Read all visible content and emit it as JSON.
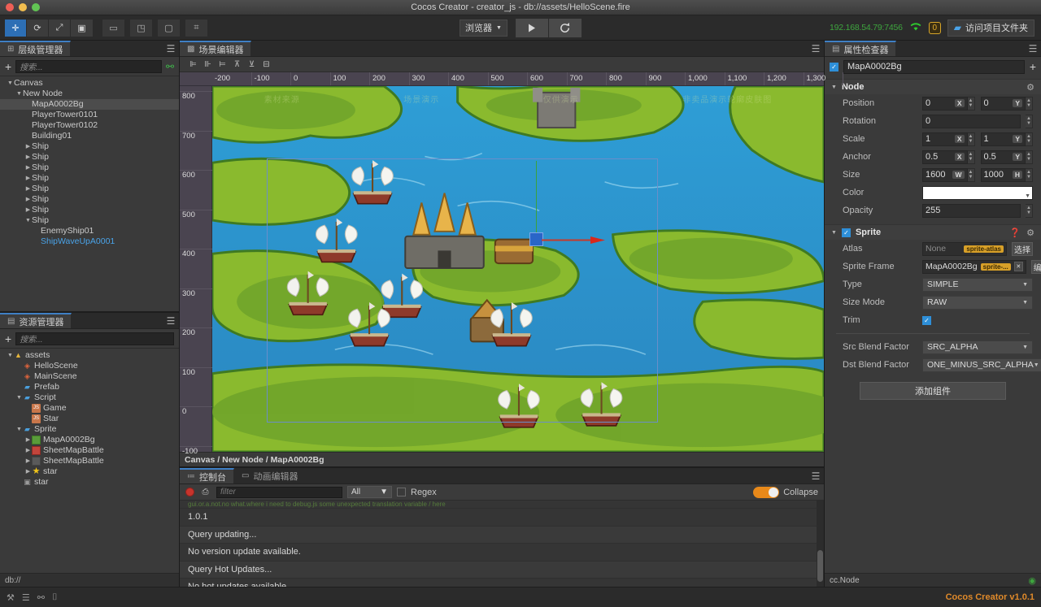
{
  "window": {
    "title": "Cocos Creator - creator_js - db://assets/HelloScene.fire"
  },
  "toolbar": {
    "left_tools": [
      {
        "name": "move-tool",
        "glyph": "✛",
        "active": true
      },
      {
        "name": "rotate-tool",
        "glyph": "⟳",
        "active": false
      },
      {
        "name": "scale-tool",
        "glyph": "⤢",
        "active": false
      },
      {
        "name": "rect-tool",
        "glyph": "▣",
        "active": false
      }
    ],
    "transform_tools": [
      {
        "name": "pivot-toggle",
        "glyph": "▬",
        "active": false
      },
      {
        "name": "coordinate-toggle",
        "glyph": "◰",
        "active": false
      }
    ],
    "display_tools": [
      {
        "name": "gizmo-toggle",
        "glyph": "▢",
        "active": false
      },
      {
        "name": "snap-toggle",
        "glyph": "⌗",
        "active": false
      }
    ],
    "preview_target": "浏览器",
    "play_label": "▶",
    "refresh_label": "⟳",
    "ip_address": "192.168.54.79:7456",
    "wifi_icon": "wifi-icon",
    "notification_count": "0",
    "open_folder_label": "访问项目文件夹"
  },
  "hierarchy": {
    "tab_label": "层级管理器",
    "search_placeholder": "搜索...",
    "add_label": "+",
    "link_label": "⚯",
    "nodes": [
      {
        "label": "Canvas",
        "depth": 0,
        "arrow": "down",
        "selected": false,
        "blue": false
      },
      {
        "label": "New Node",
        "depth": 1,
        "arrow": "down",
        "selected": false,
        "blue": false
      },
      {
        "label": "MapA0002Bg",
        "depth": 2,
        "arrow": "none",
        "selected": true,
        "blue": false
      },
      {
        "label": "PlayerTower0101",
        "depth": 2,
        "arrow": "none",
        "selected": false,
        "blue": false
      },
      {
        "label": "PlayerTower0102",
        "depth": 2,
        "arrow": "none",
        "selected": false,
        "blue": false
      },
      {
        "label": "Building01",
        "depth": 2,
        "arrow": "none",
        "selected": false,
        "blue": false
      },
      {
        "label": "Ship",
        "depth": 2,
        "arrow": "right",
        "selected": false,
        "blue": false
      },
      {
        "label": "Ship",
        "depth": 2,
        "arrow": "right",
        "selected": false,
        "blue": false
      },
      {
        "label": "Ship",
        "depth": 2,
        "arrow": "right",
        "selected": false,
        "blue": false
      },
      {
        "label": "Ship",
        "depth": 2,
        "arrow": "right",
        "selected": false,
        "blue": false
      },
      {
        "label": "Ship",
        "depth": 2,
        "arrow": "right",
        "selected": false,
        "blue": false
      },
      {
        "label": "Ship",
        "depth": 2,
        "arrow": "right",
        "selected": false,
        "blue": false
      },
      {
        "label": "Ship",
        "depth": 2,
        "arrow": "right",
        "selected": false,
        "blue": false
      },
      {
        "label": "Ship",
        "depth": 2,
        "arrow": "down",
        "selected": false,
        "blue": false
      },
      {
        "label": "EnemyShip01",
        "depth": 3,
        "arrow": "none",
        "selected": false,
        "blue": false
      },
      {
        "label": "ShipWaveUpA0001",
        "depth": 3,
        "arrow": "none",
        "selected": false,
        "blue": true
      }
    ]
  },
  "assets": {
    "tab_label": "资源管理器",
    "search_placeholder": "搜索...",
    "add_label": "+",
    "db_path": "db://",
    "nodes": [
      {
        "label": "assets",
        "depth": 0,
        "arrow": "down",
        "icon": "assets-root"
      },
      {
        "label": "HelloScene",
        "depth": 1,
        "arrow": "none",
        "icon": "fire"
      },
      {
        "label": "MainScene",
        "depth": 1,
        "arrow": "none",
        "icon": "fire"
      },
      {
        "label": "Prefab",
        "depth": 1,
        "arrow": "none",
        "icon": "folder"
      },
      {
        "label": "Script",
        "depth": 1,
        "arrow": "down",
        "icon": "folder"
      },
      {
        "label": "Game",
        "depth": 2,
        "arrow": "none",
        "icon": "js"
      },
      {
        "label": "Star",
        "depth": 2,
        "arrow": "none",
        "icon": "js"
      },
      {
        "label": "Sprite",
        "depth": 1,
        "arrow": "down",
        "icon": "folder"
      },
      {
        "label": "MapA0002Bg",
        "depth": 2,
        "arrow": "right",
        "icon": "sprite-green"
      },
      {
        "label": "SheetMapBattle",
        "depth": 2,
        "arrow": "right",
        "icon": "sprite-red"
      },
      {
        "label": "SheetMapBattle",
        "depth": 2,
        "arrow": "right",
        "icon": "sprite-dim"
      },
      {
        "label": "star",
        "depth": 2,
        "arrow": "right",
        "icon": "star"
      },
      {
        "label": "star",
        "depth": 1,
        "arrow": "none",
        "icon": "pkg"
      }
    ]
  },
  "scene": {
    "tab_label": "场景编辑器",
    "align_tools": [
      {
        "name": "align-left-icon",
        "glyph": "⊫"
      },
      {
        "name": "align-center-h-icon",
        "glyph": "⊪"
      },
      {
        "name": "align-right-icon",
        "glyph": "⊨"
      },
      {
        "name": "align-top-icon",
        "glyph": "⊼"
      },
      {
        "name": "align-middle-icon",
        "glyph": "⊻"
      },
      {
        "name": "align-bottom-icon",
        "glyph": "⊟"
      }
    ],
    "ruler_h_ticks": [
      "-200",
      "-100",
      "0",
      "100",
      "200",
      "300",
      "400",
      "500",
      "600",
      "700",
      "800",
      "900",
      "1,000",
      "1,100",
      "1,200",
      "1,300"
    ],
    "ruler_v_ticks": [
      "800",
      "700",
      "600",
      "500",
      "400",
      "300",
      "200",
      "100",
      "0",
      "-100"
    ],
    "breadcrumb": "Canvas / New Node / MapA0002Bg",
    "watermarks": [
      "素材来源",
      "场景演示",
      "仅供演示",
      "非卖品演示轮廓皮肤图"
    ]
  },
  "console": {
    "tabs": [
      {
        "label": "控制台",
        "icon": "console-icon",
        "active": true
      },
      {
        "label": "动画编辑器",
        "icon": "animation-icon",
        "active": false
      }
    ],
    "record_label": "●",
    "clear_label": "⎙",
    "filter_placeholder": "filter",
    "level": "All",
    "regex_label": "Regex",
    "collapse_label": "Collapse",
    "clipped_line": "gui.or.a.not.no  what.where  i need to debug.js  some unexpected translation variable  /  here",
    "lines": [
      "1.0.1",
      "Query updating...",
      "No version update available.",
      "Query Hot Updates...",
      "No hot updates available."
    ]
  },
  "inspector": {
    "tab_label": "属性检查器",
    "node_name": "MapA0002Bg",
    "enabled": true,
    "add_label": "+",
    "node_section": {
      "title": "Node",
      "gear": "gear-icon",
      "position": {
        "label": "Position",
        "x": "0",
        "y": "0",
        "x_axis": "X",
        "y_axis": "Y"
      },
      "rotation": {
        "label": "Rotation",
        "value": "0"
      },
      "scale": {
        "label": "Scale",
        "x": "1",
        "y": "1",
        "x_axis": "X",
        "y_axis": "Y"
      },
      "anchor": {
        "label": "Anchor",
        "x": "0.5",
        "y": "0.5",
        "x_axis": "X",
        "y_axis": "Y"
      },
      "size": {
        "label": "Size",
        "w": "1600",
        "h": "1000",
        "w_axis": "W",
        "h_axis": "H"
      },
      "color": {
        "label": "Color",
        "value": "#ffffff"
      },
      "opacity": {
        "label": "Opacity",
        "value": "255"
      }
    },
    "sprite_section": {
      "title": "Sprite",
      "enabled": true,
      "help": "help-icon",
      "gear": "gear-icon",
      "atlas": {
        "label": "Atlas",
        "value": "None",
        "tag": "sprite-atlas",
        "button": "选择"
      },
      "sprite_frame": {
        "label": "Sprite Frame",
        "value": "MapA0002Bg",
        "tag": "sprite-...",
        "button": "编辑"
      },
      "type": {
        "label": "Type",
        "value": "SIMPLE"
      },
      "size_mode": {
        "label": "Size Mode",
        "value": "RAW"
      },
      "trim": {
        "label": "Trim",
        "checked": true
      },
      "src_blend": {
        "label": "Src Blend Factor",
        "value": "SRC_ALPHA"
      },
      "dst_blend": {
        "label": "Dst Blend Factor",
        "value": "ONE_MINUS_SRC_ALPHA"
      }
    },
    "add_component_label": "添加组件",
    "status": "cc.Node"
  },
  "statusbar": {
    "icons": [
      {
        "name": "build-icon",
        "glyph": "⚒"
      },
      {
        "name": "tasks-icon",
        "glyph": "☰"
      },
      {
        "name": "link-status-icon",
        "glyph": "⚯"
      },
      {
        "name": "info-icon",
        "glyph": "⌷"
      }
    ],
    "version": "Cocos Creator v1.0.1"
  },
  "colors": {
    "accent_blue": "#2d6fb5",
    "orange": "#e08a2a",
    "green": "#3ea53e",
    "panel_bg": "#3a3a3a",
    "selection": "#4c4c4c"
  }
}
